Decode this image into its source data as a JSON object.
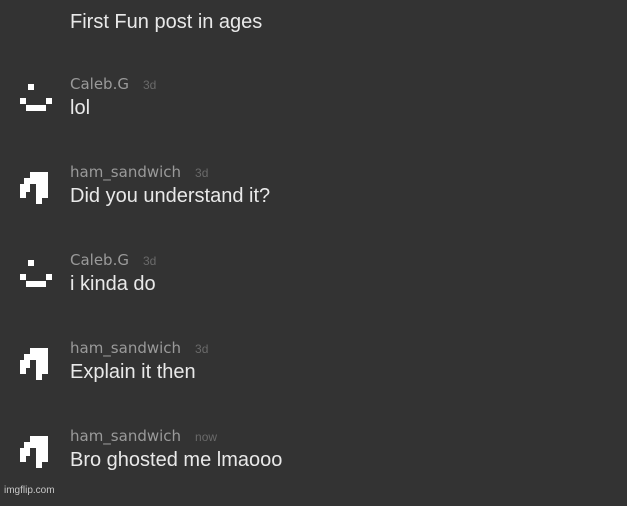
{
  "thread": {
    "top_message": "First Fun post in ages"
  },
  "comments": [
    {
      "username": "Caleb.G",
      "time": "3d",
      "text": "lol",
      "avatar_icon": "smiley-face-icon"
    },
    {
      "username": "ham_sandwich",
      "time": "3d",
      "text": "Did you understand it?",
      "avatar_icon": "pixel-ghost-icon"
    },
    {
      "username": "Caleb.G",
      "time": "3d",
      "text": "i kinda do",
      "avatar_icon": "smiley-face-icon"
    },
    {
      "username": "ham_sandwich",
      "time": "3d",
      "text": "Explain it then",
      "avatar_icon": "pixel-ghost-icon"
    },
    {
      "username": "ham_sandwich",
      "time": "now",
      "text": "Bro ghosted me lmaooo",
      "avatar_icon": "pixel-ghost-icon"
    }
  ],
  "watermark": "imgflip.com",
  "colors": {
    "background": "#333333",
    "text": "#e9e9e9",
    "username": "#9a9a9a",
    "timestamp": "#6a6a6a",
    "avatar": "#ffffff"
  }
}
